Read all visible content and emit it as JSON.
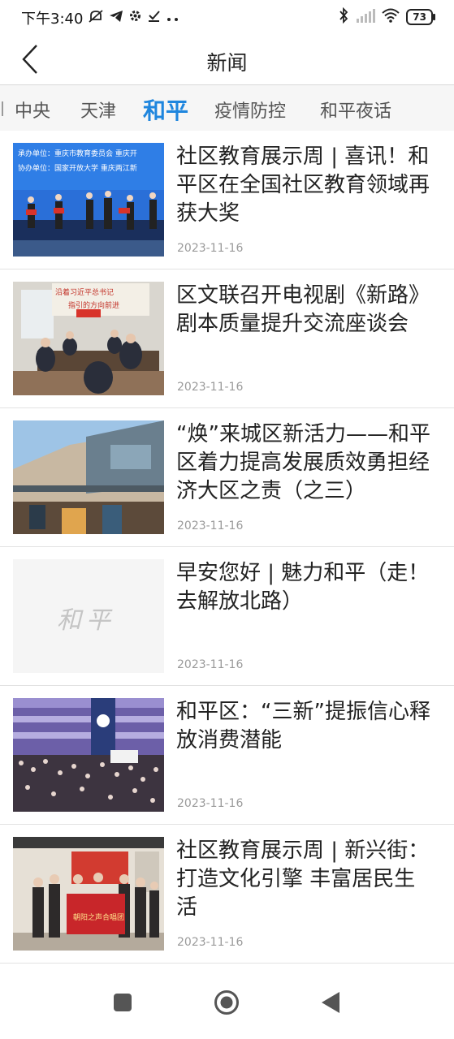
{
  "status_bar": {
    "time": "下午3:40",
    "battery": "73"
  },
  "header": {
    "title": "新闻"
  },
  "tabs": [
    {
      "label": "中央",
      "active": false
    },
    {
      "label": "天津",
      "active": false
    },
    {
      "label": "和平",
      "active": true
    },
    {
      "label": "疫情防控",
      "active": false
    },
    {
      "label": "和平夜话",
      "active": false
    }
  ],
  "news": [
    {
      "title": "社区教育展示周 | 喜讯！和平区在全国社区教育领域再获大奖",
      "date": "2023-11-16"
    },
    {
      "title": "区文联召开电视剧《新路》剧本质量提升交流座谈会",
      "date": "2023-11-16"
    },
    {
      "title": "“焕”来城区新活力——和平区着力提高发展质效勇担经济大区之责（之三）",
      "date": "2023-11-16"
    },
    {
      "title": "早安您好 | 魅力和平（走！去解放北路）",
      "date": "2023-11-16"
    },
    {
      "title": "和平区：“三新”提振信心释放消费潜能",
      "date": "2023-11-16"
    },
    {
      "title": "社区教育展示周 | 新兴街：打造文化引擎 丰富居民生活",
      "date": "2023-11-16"
    }
  ],
  "thumbnails": {
    "t1_banner_line1": "承办单位：重庆市教育委员会  重庆开",
    "t1_banner_line2": "协办单位：国家开放大学  重庆两江新",
    "t2_banner_line1": "沿着习近平总书记",
    "t2_banner_line2": "指引的方向前进",
    "t4_watermark": "和平",
    "t6_banner": "朝阳之声合唱团"
  },
  "colors": {
    "accent": "#1f86de",
    "text": "#222222",
    "date": "#9a9a9a"
  }
}
